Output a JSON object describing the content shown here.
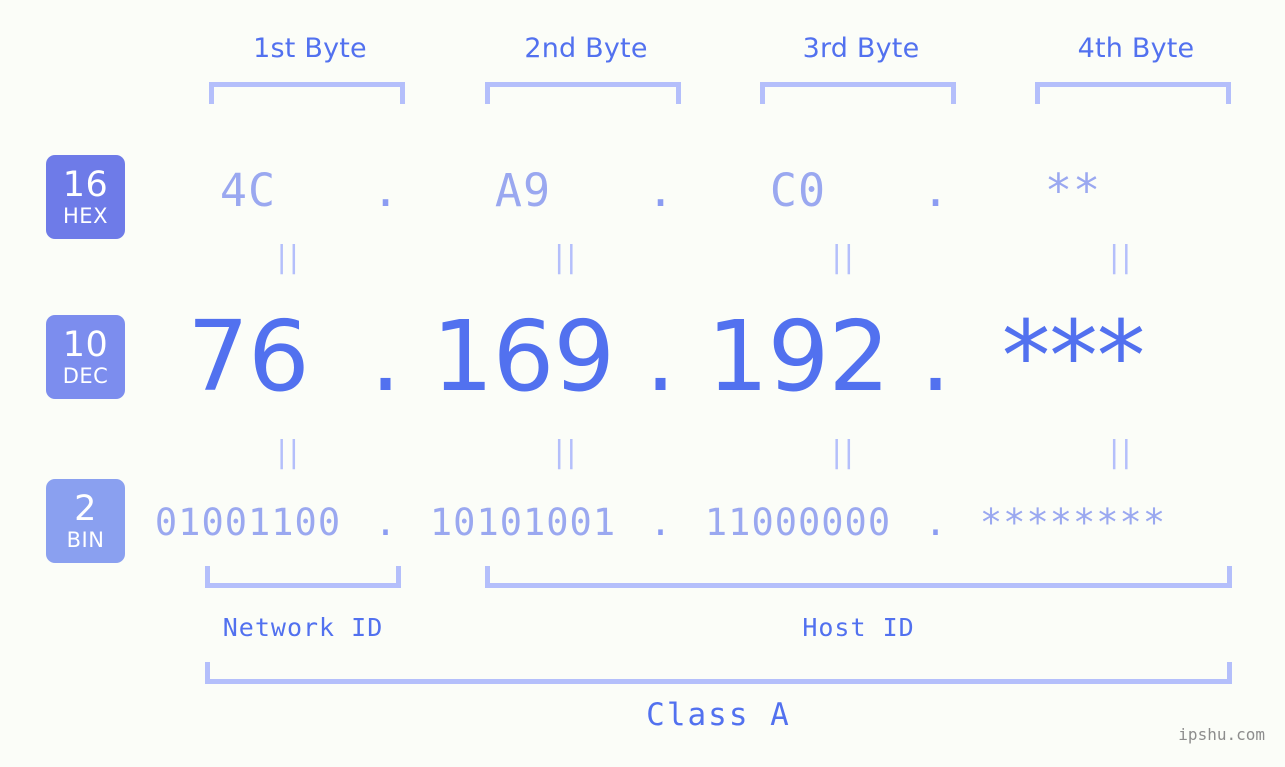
{
  "meta": {
    "watermark": "ipshu.com",
    "background_color": "#fbfdf8",
    "accent_color": "#5271ef",
    "light_accent_color": "#9aa8f0",
    "bracket_color": "#b4bffb"
  },
  "byte_headers": [
    {
      "label": "1st Byte"
    },
    {
      "label": "2nd Byte"
    },
    {
      "label": "3rd Byte"
    },
    {
      "label": "4th Byte"
    }
  ],
  "rows": [
    {
      "badge_number": "16",
      "badge_name": "HEX",
      "badge_color": "#6e7be8",
      "values": [
        "4C",
        "A9",
        "C0",
        "**"
      ],
      "separator": "."
    },
    {
      "badge_number": "10",
      "badge_name": "DEC",
      "badge_color": "#7c8dee",
      "values": [
        "76",
        "169",
        "192",
        "***"
      ],
      "separator": "."
    },
    {
      "badge_number": "2",
      "badge_name": "BIN",
      "badge_color": "#8aa0f0",
      "values": [
        "01001100",
        "10101001",
        "11000000",
        "********"
      ],
      "separator": "."
    }
  ],
  "equals_marks": [
    "||",
    "||",
    "||",
    "||"
  ],
  "footer": {
    "network_id_label": "Network ID",
    "host_id_label": "Host ID",
    "class_label": "Class A"
  }
}
